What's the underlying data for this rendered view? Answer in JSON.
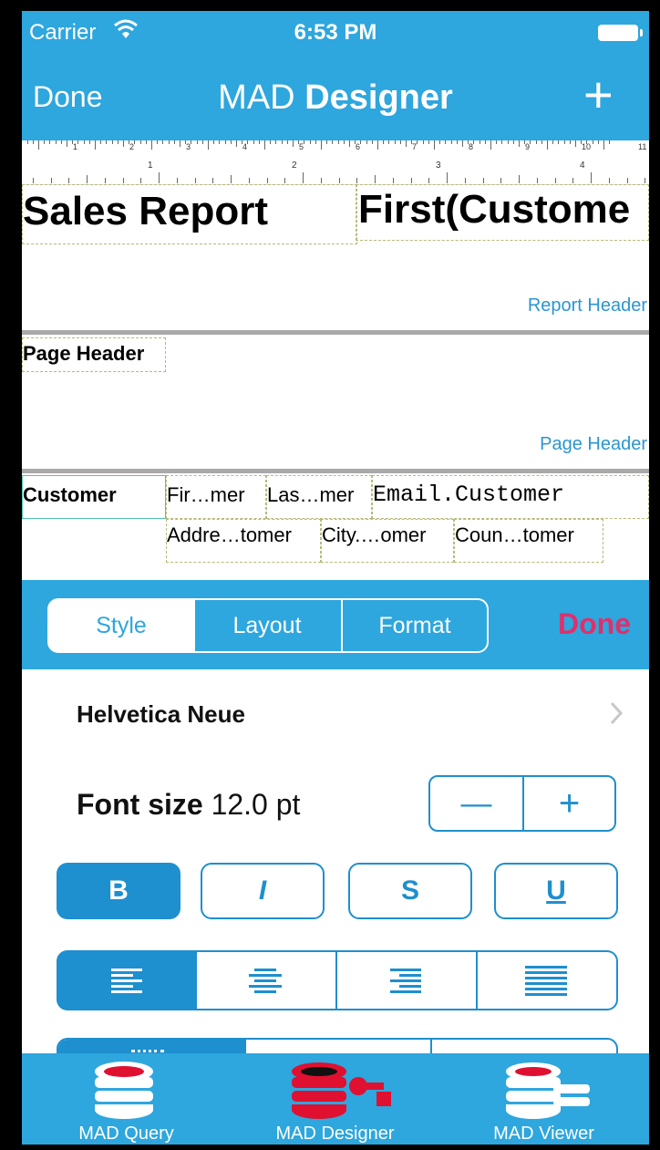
{
  "status": {
    "carrier": "Carrier",
    "time": "6:53 PM"
  },
  "nav": {
    "done": "Done",
    "title_light": "MAD",
    "title_bold": "Designer",
    "add_symbol": "+"
  },
  "ruler": {
    "cm_labels": [
      "1",
      "2",
      "3",
      "4",
      "5",
      "6",
      "7",
      "8",
      "9",
      "10",
      "11"
    ],
    "inch_labels": [
      "1",
      "2",
      "3",
      "4"
    ]
  },
  "report": {
    "title_text": "Sales Report",
    "title_field": "First(Custome",
    "report_header_label": "Report Header",
    "page_header_text": "Page Header",
    "page_header_label": "Page Header",
    "detail": {
      "group_label": "Customer",
      "row1": [
        "Fir…mer",
        "Las…mer",
        "Email.Customer"
      ],
      "row2": [
        "Addre…tomer",
        "City.…omer",
        "Coun…tomer"
      ]
    }
  },
  "panel": {
    "tabs": [
      {
        "label": "Style",
        "active": true
      },
      {
        "label": "Layout",
        "active": false
      },
      {
        "label": "Format",
        "active": false
      }
    ],
    "done": "Done",
    "font_name": "Helvetica Neue",
    "font_size_label": "Font size",
    "font_size_value": "12.0 pt",
    "minus": "—",
    "plus": "+",
    "style_buttons": [
      {
        "label": "B",
        "on": true
      },
      {
        "label": "I",
        "on": false
      },
      {
        "label": "S",
        "on": false
      },
      {
        "label": "U",
        "on": false
      }
    ],
    "alignment_selected": "left"
  },
  "colors": {
    "brand_blue": "#2ea6de",
    "control_blue": "#1e8fcf",
    "done_red": "#e0306a",
    "icon_red": "#e01030"
  },
  "tabbar": {
    "items": [
      {
        "label": "MAD Query",
        "icon": "database-icon"
      },
      {
        "label": "MAD Designer",
        "icon": "designer-database-icon",
        "active": true
      },
      {
        "label": "MAD Viewer",
        "icon": "viewer-database-icon"
      }
    ]
  }
}
